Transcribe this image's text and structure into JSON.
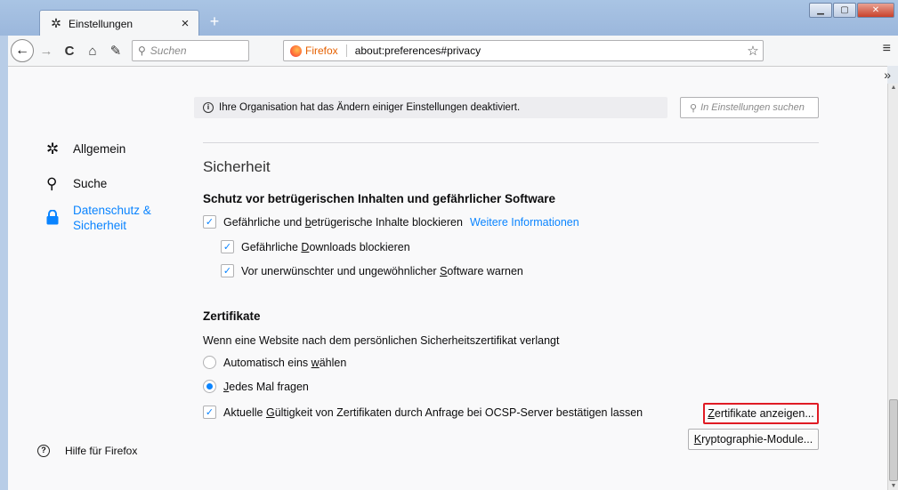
{
  "window": {
    "tab_title": "Einstellungen",
    "tab_close": "×",
    "new_tab": "+"
  },
  "toolbar": {
    "back_icon": "←",
    "forward_icon": "→",
    "reload_icon": "C",
    "home_icon": "⌂",
    "customize_icon": "✎",
    "search_placeholder": "Suchen",
    "identity_label": "Firefox",
    "url": "about:preferences#privacy",
    "bookmark_icon": "☆",
    "menu_icon": "≡",
    "overflow_icon": "»"
  },
  "sidebar": {
    "items": [
      {
        "icon": "gear-icon",
        "glyph": "✲",
        "label": "Allgemein"
      },
      {
        "icon": "search-icon",
        "glyph": "⚲",
        "label": "Suche"
      },
      {
        "icon": "lock-icon",
        "glyph": "🔒",
        "label_line1": "Datenschutz &",
        "label_line2": "Sicherheit"
      }
    ],
    "help_label": "Hilfe für Firefox"
  },
  "policy_notice": "Ihre Organisation hat das Ändern einiger Einstellungen deaktiviert.",
  "pref_search_placeholder": "In Einstellungen suchen",
  "section_title": "Sicherheit",
  "protection": {
    "heading": "Schutz vor betrügerischen Inhalten und gefährlicher Software",
    "block_dangerous": {
      "pre": "Gefährliche und ",
      "accel": "b",
      "post": "etrügerische Inhalte blockieren",
      "checked": true
    },
    "more_info": "Weitere Informationen",
    "block_downloads": {
      "pre": "Gefährliche ",
      "accel": "D",
      "post": "ownloads blockieren",
      "checked": true
    },
    "warn_software": {
      "pre": "Vor unerwünschter und ungewöhnlicher ",
      "accel": "S",
      "post": "oftware warnen",
      "checked": true
    }
  },
  "certificates": {
    "heading": "Zertifikate",
    "description": "Wenn eine Website nach dem persönlichen Sicherheitszertifikat verlangt",
    "auto_select": {
      "pre": "Automatisch eins ",
      "accel": "w",
      "post": "ählen",
      "selected": false
    },
    "ask_every_time": {
      "pre": "",
      "accel": "J",
      "post": "edes Mal fragen",
      "selected": true
    },
    "ocsp": {
      "pre": "Aktuelle ",
      "accel": "G",
      "post": "ültigkeit von Zertifikaten durch Anfrage bei OCSP-Server bestätigen lassen",
      "checked": true
    },
    "view_certs_button": {
      "pre": "",
      "accel": "Z",
      "post": "ertifikate anzeigen..."
    },
    "security_devices_button": {
      "pre": "",
      "accel": "K",
      "post": "ryptographie-Module..."
    }
  },
  "colors": {
    "accent": "#0a84ff",
    "highlight": "#e01b24"
  }
}
